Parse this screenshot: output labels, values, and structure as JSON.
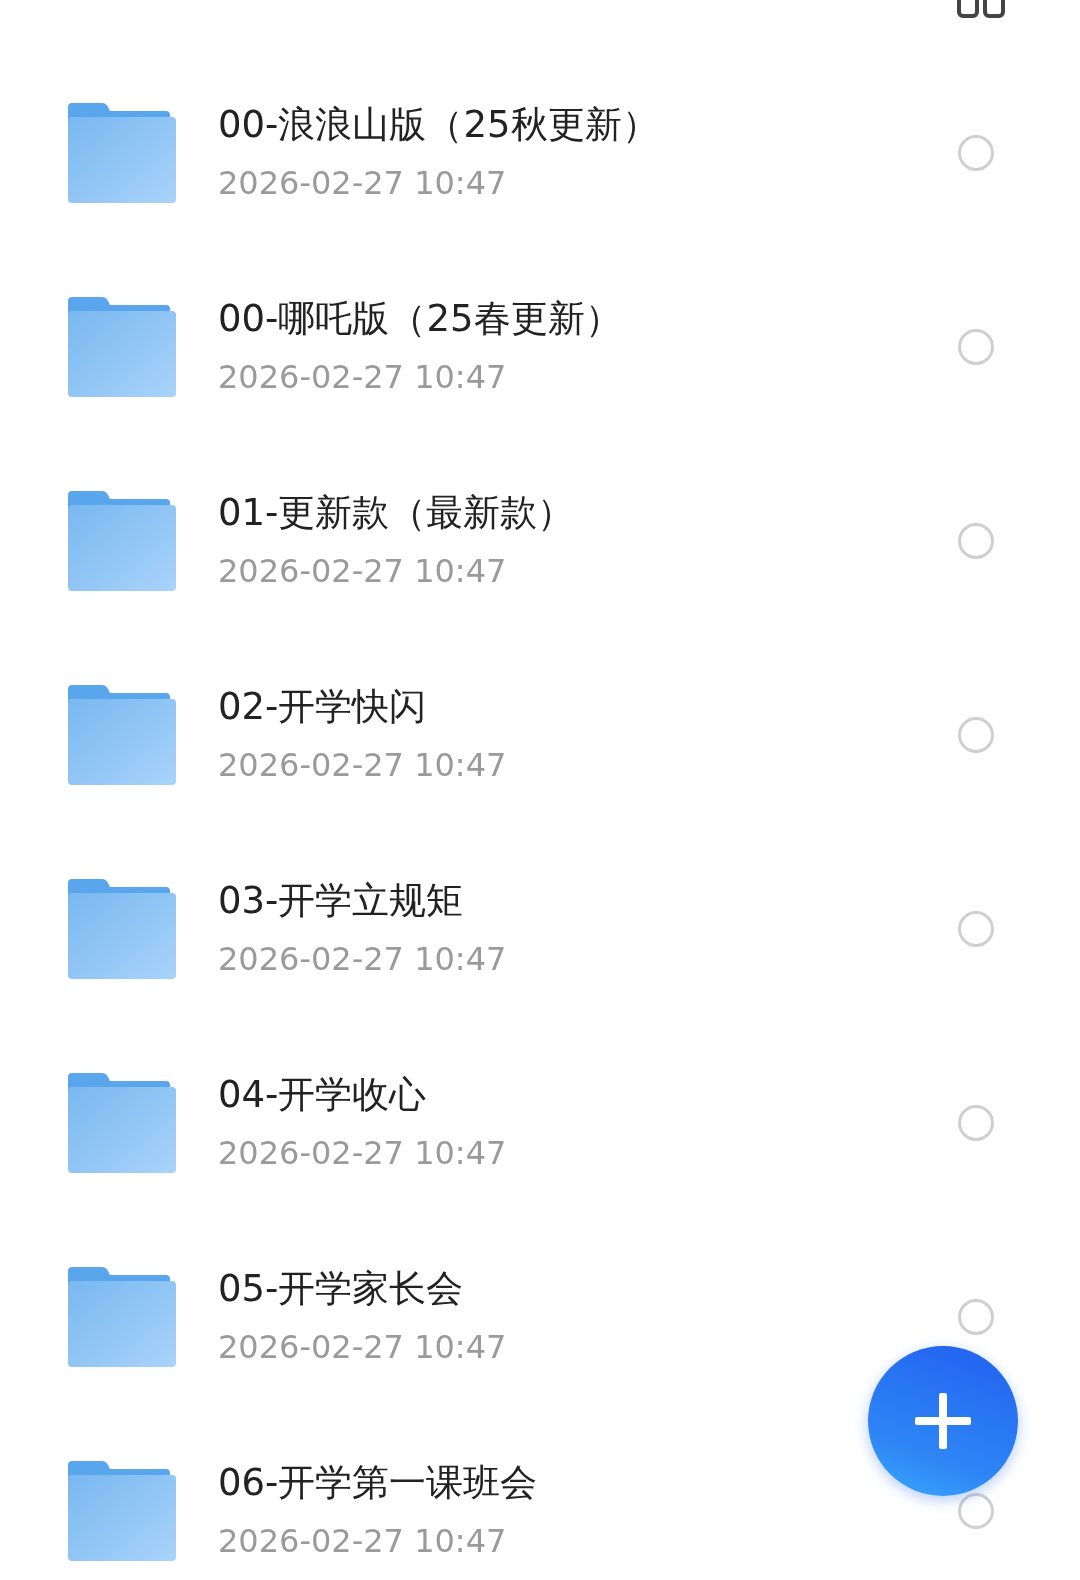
{
  "folders": [
    {
      "name": "00-浪浪山版（25秋更新）",
      "modified": "2026-02-27 10:47",
      "selected": false
    },
    {
      "name": "00-哪吒版（25春更新）",
      "modified": "2026-02-27 10:47",
      "selected": false
    },
    {
      "name": "01-更新款（最新款）",
      "modified": "2026-02-27 10:47",
      "selected": false
    },
    {
      "name": "02-开学快闪",
      "modified": "2026-02-27 10:47",
      "selected": false
    },
    {
      "name": "03-开学立规矩",
      "modified": "2026-02-27 10:47",
      "selected": false
    },
    {
      "name": "04-开学收心",
      "modified": "2026-02-27 10:47",
      "selected": false
    },
    {
      "name": "05-开学家长会",
      "modified": "2026-02-27 10:47",
      "selected": false
    },
    {
      "name": "06-开学第一课班会",
      "modified": "2026-02-27 10:47",
      "selected": false
    }
  ]
}
